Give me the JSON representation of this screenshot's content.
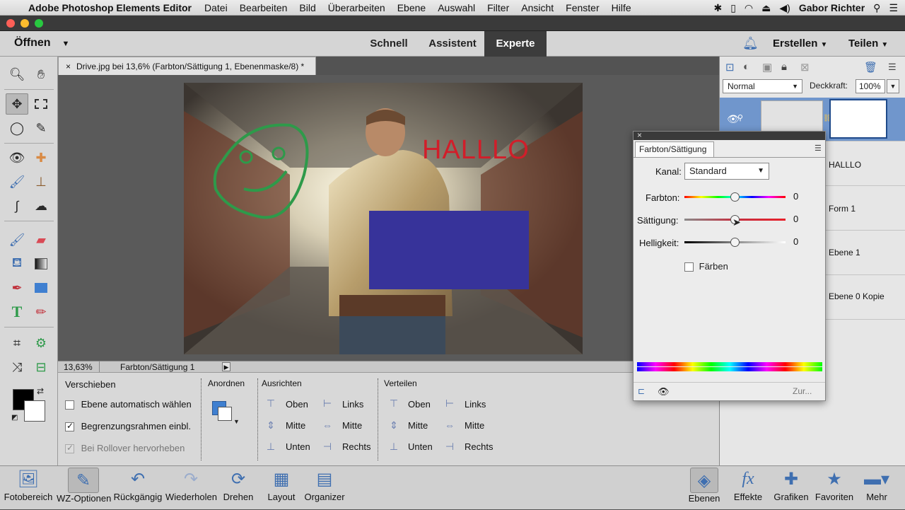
{
  "menubar": {
    "app_name": "Adobe Photoshop Elements Editor",
    "items": [
      "Datei",
      "Bearbeiten",
      "Bild",
      "Überarbeiten",
      "Ebene",
      "Auswahl",
      "Filter",
      "Ansicht",
      "Fenster",
      "Hilfe"
    ],
    "user": "Gabor Richter"
  },
  "header": {
    "open_label": "Öffnen",
    "modes": [
      "Schnell",
      "Assistent",
      "Experte"
    ],
    "active_mode": "Experte",
    "create_label": "Erstellen",
    "share_label": "Teilen"
  },
  "document": {
    "tab_title": "Drive.jpg bei 13,6% (Farbton/Sättigung 1, Ebenenmaske/8) *",
    "canvas_text": "HALLLO",
    "zoom": "13,63%",
    "status_info": "Farbton/Sättigung 1"
  },
  "options": {
    "tool_title": "Verschieben",
    "auto_select": "Ebene automatisch wählen",
    "bounding_box": "Begrenzungsrahmen einbl.",
    "rollover": "Bei Rollover hervorheben",
    "arrange_title": "Anordnen",
    "align_title": "Ausrichten",
    "align_col1": [
      "Oben",
      "Mitte",
      "Unten"
    ],
    "align_col2": [
      "Links",
      "Mitte",
      "Rechts"
    ],
    "distribute_title": "Verteilen",
    "dist_col1": [
      "Oben",
      "Mitte",
      "Unten"
    ],
    "dist_col2": [
      "Links",
      "Mitte",
      "Rechts"
    ]
  },
  "layers": {
    "blend_mode": "Normal",
    "opacity_label": "Deckkraft:",
    "opacity_value": "100%",
    "rows": [
      "HALLLO",
      "Form 1",
      "Ebene 1",
      "Ebene 0 Kopie"
    ]
  },
  "hue_sat": {
    "tab_label": "Farbton/Sättigung",
    "channel_label": "Kanal:",
    "channel_value": "Standard",
    "hue_label": "Farbton:",
    "hue_value": "0",
    "hue_level": 0.5,
    "sat_label": "Sättigung:",
    "sat_value": "0",
    "sat_level": 0.5,
    "light_label": "Helligkeit:",
    "light_value": "0",
    "light_level": 0.5,
    "colorize_label": "Färben",
    "reset_label": "Zur..."
  },
  "bottom": {
    "buttons": [
      "Fotobereich",
      "WZ-Optionen",
      "Rückgängig",
      "Wiederholen",
      "Drehen",
      "Layout",
      "Organizer"
    ],
    "right_buttons": [
      "Ebenen",
      "Effekte",
      "Grafiken",
      "Favoriten",
      "Mehr"
    ]
  },
  "colors": {
    "accent_blue": "#3f6fb0",
    "rect_fill": "#37339a",
    "halllo_red": "#d11e2a",
    "smiley_green": "#2e9a4a"
  }
}
